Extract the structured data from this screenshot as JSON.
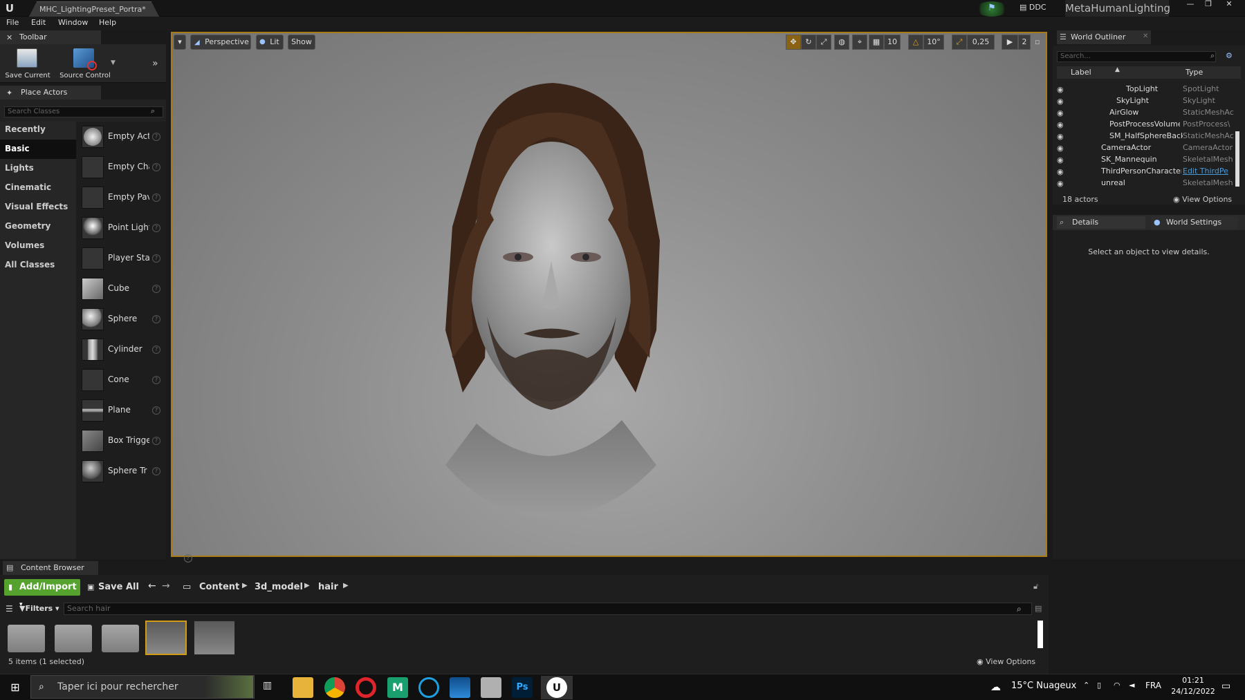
{
  "window": {
    "tab_title": "MHC_LightingPreset_Portra*",
    "ddc_label": "DDC",
    "project_name": "MetaHumanLighting"
  },
  "menu": [
    "File",
    "Edit",
    "Window",
    "Help"
  ],
  "toolbar": {
    "tab_label": "Toolbar",
    "save_label": "Save Current",
    "source_control_label": "Source Control"
  },
  "place_actors": {
    "tab_label": "Place Actors",
    "search_placeholder": "Search Classes",
    "categories": [
      "Recently Placed",
      "Basic",
      "Lights",
      "Cinematic",
      "Visual Effects",
      "Geometry",
      "Volumes",
      "All Classes"
    ],
    "selected_category": "Basic",
    "actors": [
      "Empty Act",
      "Empty Cha",
      "Empty Pav",
      "Point Light",
      "Player Sta",
      "Cube",
      "Sphere",
      "Cylinder",
      "Cone",
      "Plane",
      "Box Trigge",
      "Sphere Tr"
    ]
  },
  "viewport": {
    "perspective_label": "Perspective",
    "lit_label": "Lit",
    "show_label": "Show",
    "grid_snap": "10",
    "rotation_snap": "10°",
    "scale_snap": "0,25",
    "camera_speed": "2"
  },
  "world_outliner": {
    "tab_label": "World Outliner",
    "search_placeholder": "Search...",
    "col_label": "Label",
    "col_type": "Type",
    "rows": [
      {
        "label": "TopLight",
        "type": "SpotLight"
      },
      {
        "label": "SkyLight",
        "type": "SkyLight"
      },
      {
        "label": "AirGlow",
        "type": "StaticMeshAc"
      },
      {
        "label": "PostProcessVolume",
        "type": "PostProcess\\"
      },
      {
        "label": "SM_HalfSphereBackg",
        "type": "StaticMeshAc"
      },
      {
        "label": "CameraActor",
        "type": "CameraActor"
      },
      {
        "label": "SK_Mannequin",
        "type": "SkeletalMesh"
      },
      {
        "label": "ThirdPersonCharacter",
        "type": "Edit ThirdPe"
      },
      {
        "label": "unreal",
        "type": "SkeletalMesh"
      }
    ],
    "actor_count": "18 actors",
    "view_options": "View Options"
  },
  "details": {
    "tab_label": "Details",
    "world_settings_label": "World Settings",
    "empty_message": "Select an object to view details."
  },
  "content_browser": {
    "tab_label": "Content Browser",
    "add_import_label": "Add/Import",
    "save_all_label": "Save All",
    "path": [
      "Content",
      "3d_model",
      "hair"
    ],
    "filters_label": "Filters",
    "search_placeholder": "Search hair",
    "status": "5 items (1 selected)",
    "view_options": "View Options"
  },
  "taskbar": {
    "search_placeholder": "Taper ici pour rechercher",
    "weather": "15°C  Nuageux",
    "language": "FRA",
    "time": "01:21",
    "date": "24/12/2022"
  },
  "colors": {
    "accent_selected": "#a87b17",
    "add_import": "#55a22e",
    "link": "#4a9bd9"
  }
}
